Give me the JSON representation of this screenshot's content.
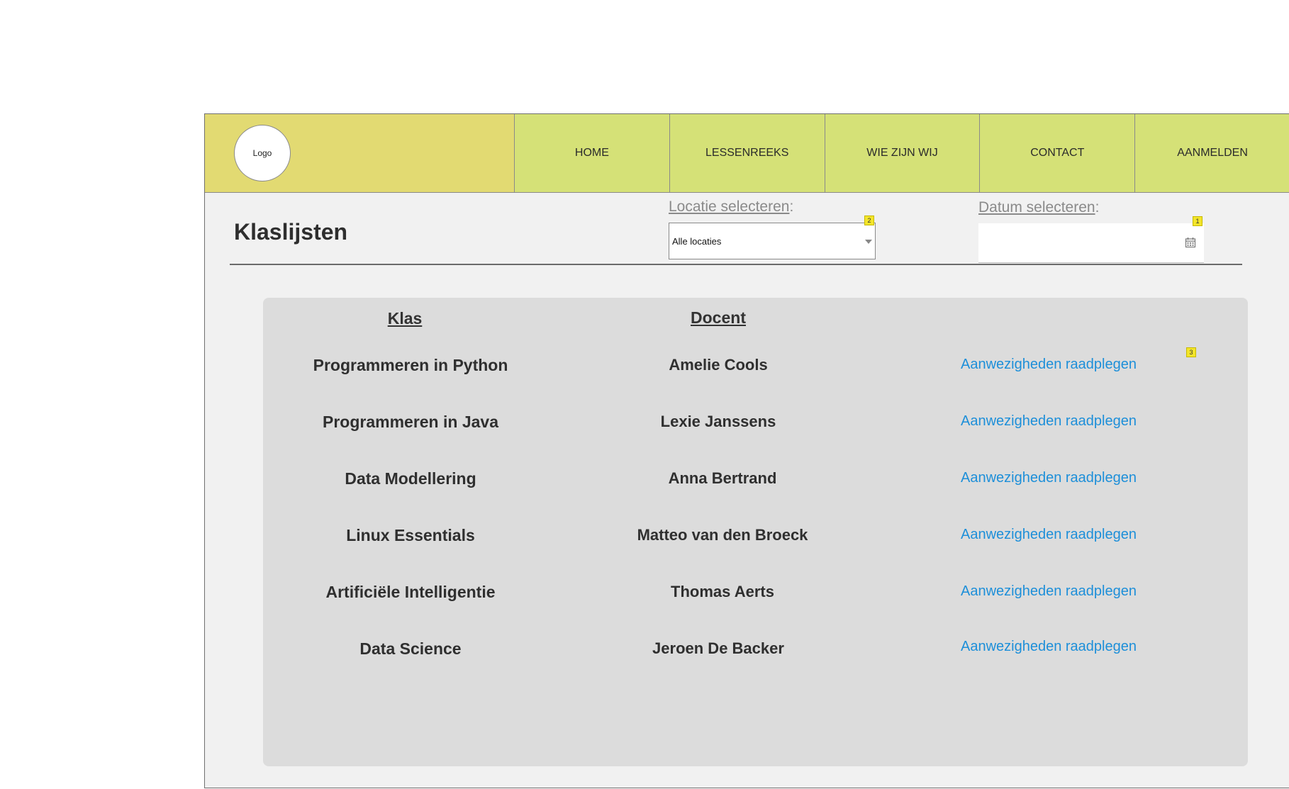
{
  "header": {
    "logo_label": "Logo",
    "nav": [
      "HOME",
      "LESSENREEKS",
      "WIE ZIJN WIJ",
      "CONTACT",
      "AANMELDEN"
    ]
  },
  "page": {
    "title": "Klaslijsten"
  },
  "filters": {
    "location": {
      "label": "Locatie selecteren",
      "colon": ":",
      "value": "Alle locaties",
      "badge": "2"
    },
    "date": {
      "label": "Datum selecteren",
      "colon": ":",
      "value": "",
      "badge": "1"
    }
  },
  "table": {
    "headers": {
      "klas": "Klas",
      "docent": "Docent"
    },
    "action_badge": "3",
    "rows": [
      {
        "klas": "Programmeren in Python",
        "docent": "Amelie Cools",
        "action": "Aanwezigheden raadplegen"
      },
      {
        "klas": "Programmeren in Java",
        "docent": "Lexie Janssens",
        "action": "Aanwezigheden raadplegen"
      },
      {
        "klas": "Data Modellering",
        "docent": "Anna Bertrand",
        "action": "Aanwezigheden raadplegen"
      },
      {
        "klas": "Linux Essentials",
        "docent": "Matteo van den Broeck",
        "action": "Aanwezigheden raadplegen"
      },
      {
        "klas": "Artificiële Intelligentie",
        "docent": "Thomas Aerts",
        "action": "Aanwezigheden raadplegen"
      },
      {
        "klas": "Data Science",
        "docent": "Jeroen De Backer",
        "action": "Aanwezigheden raadplegen"
      }
    ]
  },
  "icons": {
    "calendar": "calendar-icon",
    "dropdown": "chevron-down-icon"
  }
}
